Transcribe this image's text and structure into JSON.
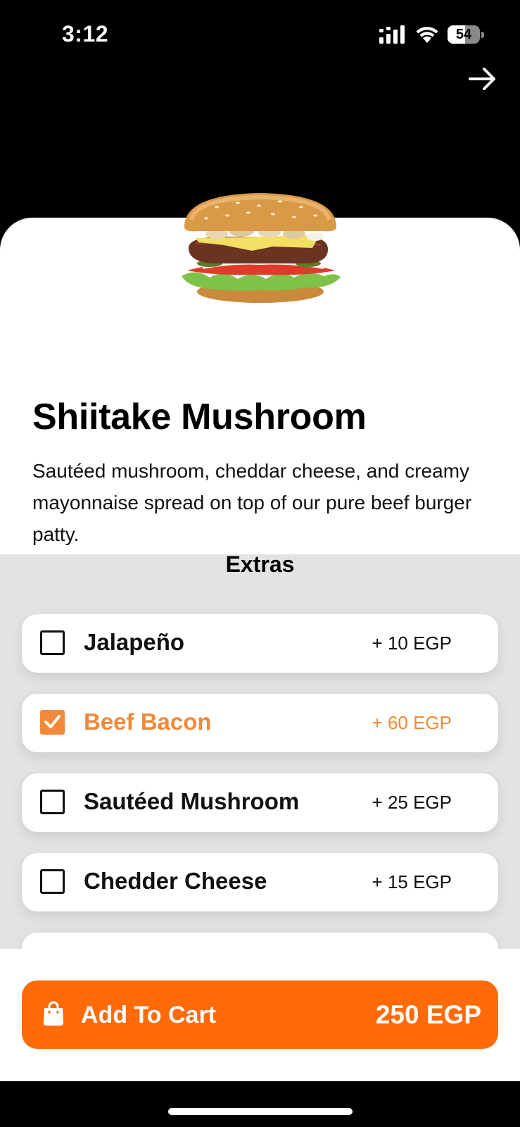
{
  "status_bar": {
    "time": "3:12",
    "battery_level": "54",
    "battery_fraction": 0.54
  },
  "product": {
    "title": "Shiitake Mushroom",
    "description": "Sautéed mushroom, cheddar cheese, and creamy mayonnaise spread on top of our pure beef burger patty."
  },
  "extras": {
    "heading": "Extras",
    "items": [
      {
        "name": "Jalapeño",
        "price": "+ 10 EGP",
        "selected": false
      },
      {
        "name": "Beef Bacon",
        "price": "+ 60 EGP",
        "selected": true
      },
      {
        "name": "Sautéed Mushroom",
        "price": "+ 25 EGP",
        "selected": false
      },
      {
        "name": "Chedder Cheese",
        "price": "+ 15 EGP",
        "selected": false
      }
    ]
  },
  "cart": {
    "label": "Add To Cart",
    "total": "250 EGP"
  },
  "colors": {
    "accent": "#ff6a0a",
    "selected_text": "#f08a3a",
    "panel_bg": "#e3e3e3"
  },
  "icons": {
    "next": "arrow-right-icon",
    "bag": "shopping-bag-icon",
    "check": "checkbox-icon"
  }
}
